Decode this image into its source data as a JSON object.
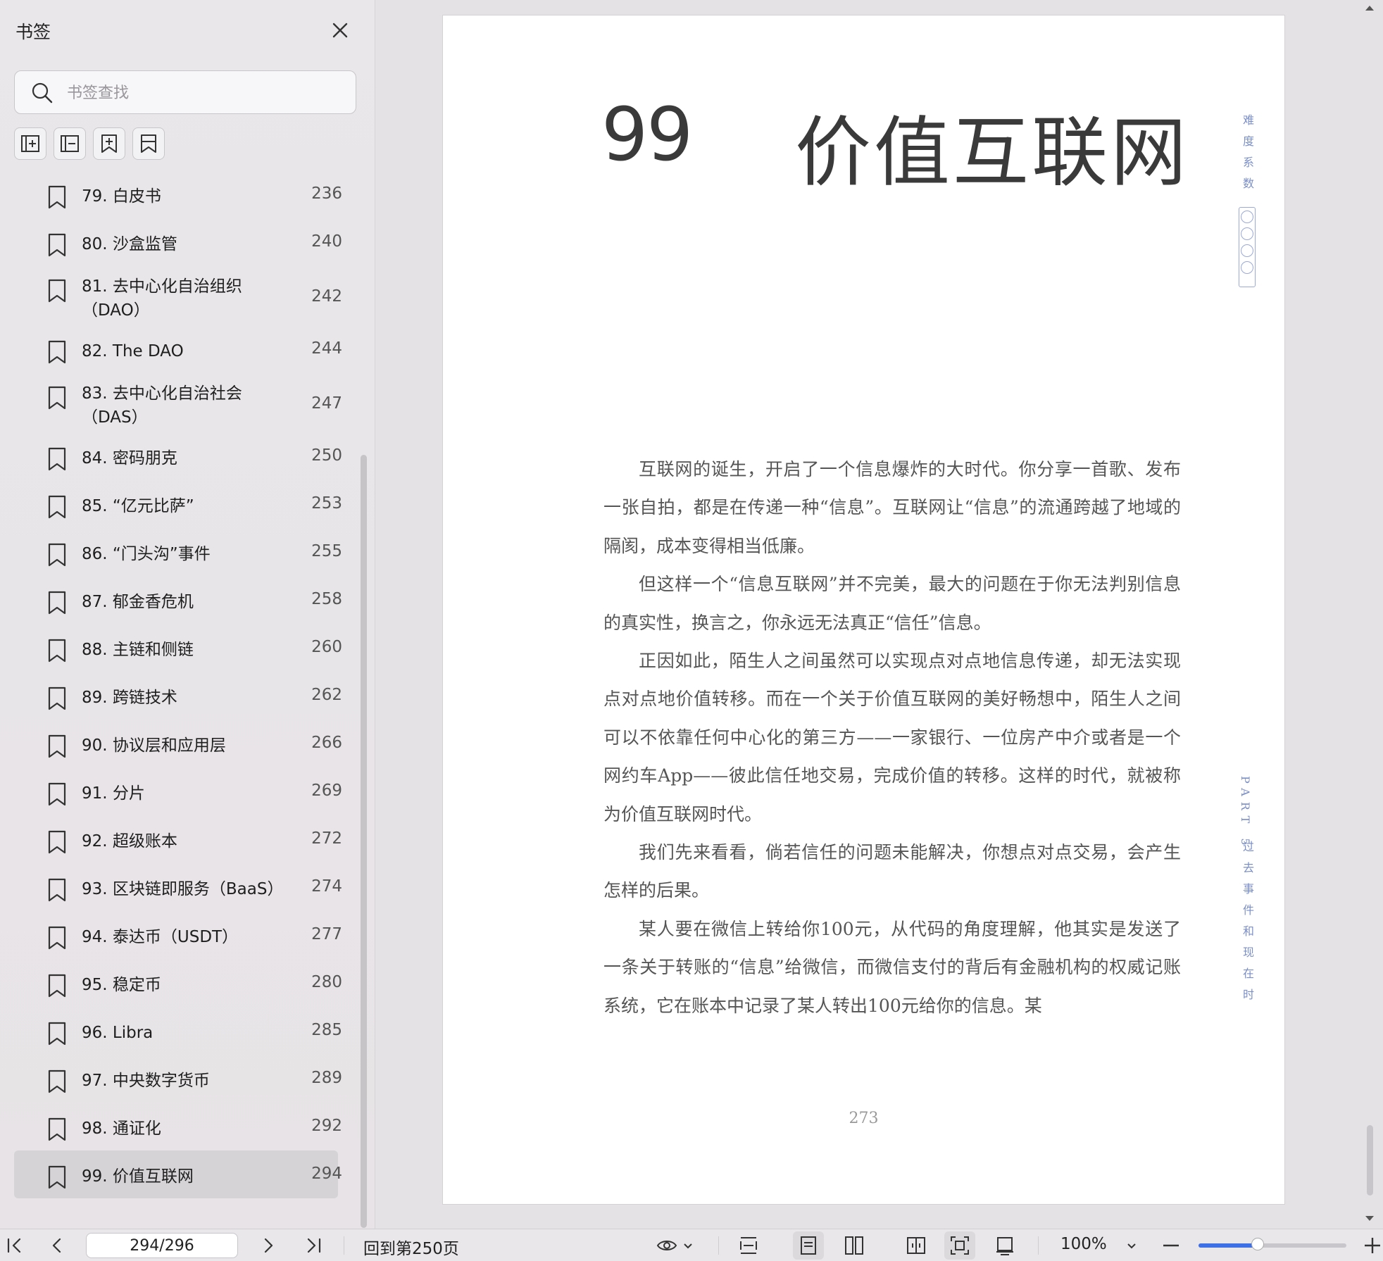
{
  "sidebar": {
    "title": "书签",
    "search_placeholder": "书签查找",
    "tools": [
      "expand-all-icon",
      "collapse-all-icon",
      "add-bookmark-icon",
      "bookmark-icon"
    ],
    "items": [
      {
        "label": "79. 白皮书",
        "page": "236"
      },
      {
        "label": "80. 沙盒监管",
        "page": "240"
      },
      {
        "label": "81. 去中心化自治组织（DAO）",
        "page": "242"
      },
      {
        "label": "82. The DAO",
        "page": "244"
      },
      {
        "label": "83. 去中心化自治社会（DAS）",
        "page": "247"
      },
      {
        "label": "84. 密码朋克",
        "page": "250"
      },
      {
        "label": "85. “亿元比萨”",
        "page": "253"
      },
      {
        "label": "86. “门头沟”事件",
        "page": "255"
      },
      {
        "label": "87. 郁金香危机",
        "page": "258"
      },
      {
        "label": "88. 主链和侧链",
        "page": "260"
      },
      {
        "label": "89. 跨链技术",
        "page": "262"
      },
      {
        "label": "90. 协议层和应用层",
        "page": "266"
      },
      {
        "label": "91. 分片",
        "page": "269"
      },
      {
        "label": "92. 超级账本",
        "page": "272"
      },
      {
        "label": "93. 区块链即服务（BaaS）",
        "page": "274"
      },
      {
        "label": "94. 泰达币（USDT）",
        "page": "277"
      },
      {
        "label": "95. 稳定币",
        "page": "280"
      },
      {
        "label": "96. Libra",
        "page": "285"
      },
      {
        "label": "97. 中央数字货币",
        "page": "289"
      },
      {
        "label": "98. 通证化",
        "page": "292"
      },
      {
        "label": "99. 价值互联网",
        "page": "294",
        "active": true
      }
    ]
  },
  "page": {
    "chapter_number": "99",
    "chapter_title": "价值互联网",
    "difficulty_label": "难度系数",
    "part_label": "PART 5",
    "part_title": "过去事件和现在时",
    "paragraphs": [
      "互联网的诞生，开启了一个信息爆炸的大时代。你分享一首歌、发布一张自拍，都是在传递一种“信息”。互联网让“信息”的流通跨越了地域的隔阂，成本变得相当低廉。",
      "但这样一个“信息互联网”并不完美，最大的问题在于你无法判别信息的真实性，换言之，你永远无法真正“信任”信息。",
      "正因如此，陌生人之间虽然可以实现点对点地信息传递，却无法实现点对点地价值转移。而在一个关于价值互联网的美好畅想中，陌生人之间可以不依靠任何中心化的第三方——一家银行、一位房产中介或者是一个网约车App——彼此信任地交易，完成价值的转移。这样的时代，就被称为价值互联网时代。",
      "我们先来看看，倘若信任的问题未能解决，你想点对点交易，会产生怎样的后果。",
      "某人要在微信上转给你100元，从代码的角度理解，他其实是发送了一条关于转账的“信息”给微信，而微信支付的背后有金融机构的权威记账系统，它在账本中记录了某人转出100元给你的信息。某"
    ],
    "page_number": "273"
  },
  "toolbar": {
    "page_value": "294/296",
    "back_label": "回到第250页",
    "zoom": "100%",
    "zoom_fraction": 0.4
  }
}
